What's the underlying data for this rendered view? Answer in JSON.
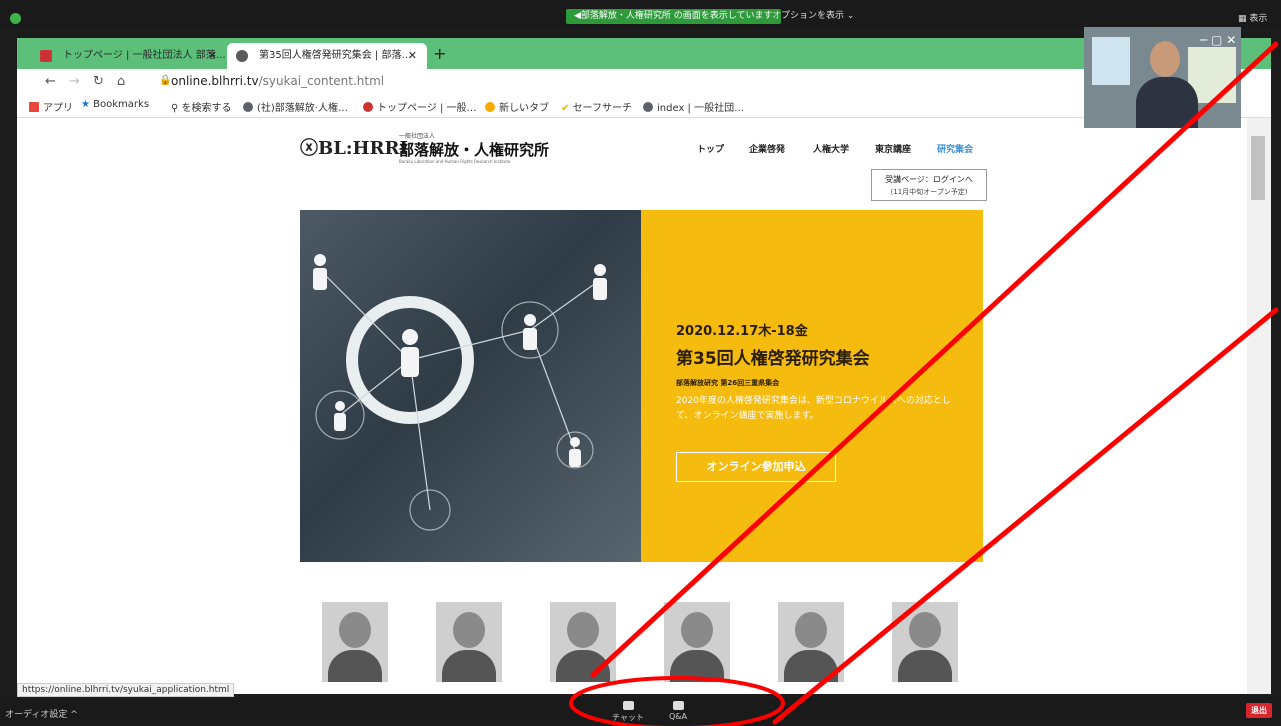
{
  "zoom": {
    "share_notice": "◀部落解放・人権研究所 の画面を表示しています",
    "options": "オプションを表示 ⌄",
    "view": "▦ 表示",
    "audio": "オーディオ設定 ^",
    "chat": "チャット",
    "qa": "Q&A",
    "leave": "退出",
    "window_controls": "─   ▢   ✕"
  },
  "browser": {
    "tabs": [
      {
        "label": "トップページ | 一般社団法人 部落…"
      },
      {
        "label": "第35回人権啓発研究集会 | 部落…"
      }
    ],
    "url_domain": "online.blhrri.tv",
    "url_path": "/syukai_content.html",
    "bookmarks": [
      {
        "label": "アプリ",
        "color": "#e8453c"
      },
      {
        "label": "Bookmarks",
        "color": "#1a73e8"
      },
      {
        "label": "を検索する",
        "color": "#5f6368"
      },
      {
        "label": "(社)部落解放·人権…",
        "color": "#5f6368"
      },
      {
        "label": "トップページ | 一般…",
        "color": "#c33"
      },
      {
        "label": "新しいタブ",
        "color": "#f9ab00"
      },
      {
        "label": "セーフサーチ",
        "color": "#e6b800"
      },
      {
        "label": "index | 一般社団…",
        "color": "#5f6368"
      }
    ],
    "status_url": "https://online.blhrri.tv/syukai_application.html"
  },
  "site": {
    "logo_mark": "ⓧBL:HRRI",
    "logo_sub": "一般社団法人",
    "logo_name": "部落解放・人権研究所",
    "logo_en": "Buraku Liberation and Human Rights Research Institute",
    "nav": [
      "トップ",
      "企業啓発",
      "人権大学",
      "東京講座",
      "研究集会"
    ],
    "login_line1": "受講ページ：ログインへ",
    "login_line2": "(11月中旬オープン予定)",
    "hero": {
      "date": "2020.12.17木-18金",
      "title": "第35回人権啓発研究集会",
      "subtitle": "部落解放研究 第26回三重県集会",
      "description": "2020年度の人権啓発研究集会は、新型コロナウイルスへの対応として、オンライン講座で実施します。",
      "button": "オンライン参加申込"
    }
  },
  "colors": {
    "tab_strip": "#5cc07b",
    "hero_panel": "#f6bb0f",
    "annotation": "#ff0000"
  }
}
